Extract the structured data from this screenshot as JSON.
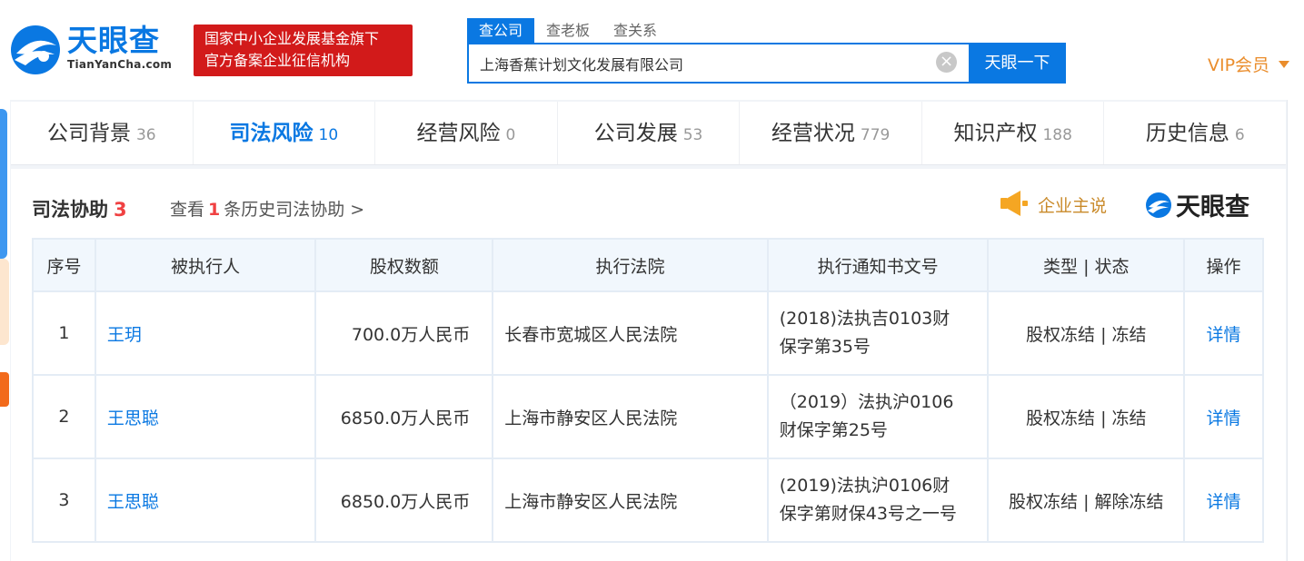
{
  "header": {
    "logo_cn": "天眼查",
    "logo_en": "TianYanCha.com",
    "gov_badge": {
      "line1": "国家中小企业发展基金旗下",
      "line2": "官方备案企业征信机构"
    },
    "search_tabs": [
      "查公司",
      "查老板",
      "查关系"
    ],
    "search_value": "上海香蕉计划文化发展有限公司",
    "search_button": "天眼一下",
    "vip": "VIP会员"
  },
  "category_tabs": [
    {
      "label": "公司背景",
      "count": "36"
    },
    {
      "label": "司法风险",
      "count": "10"
    },
    {
      "label": "经营风险",
      "count": "0"
    },
    {
      "label": "公司发展",
      "count": "53"
    },
    {
      "label": "经营状况",
      "count": "779"
    },
    {
      "label": "知识产权",
      "count": "188"
    },
    {
      "label": "历史信息",
      "count": "6"
    }
  ],
  "section": {
    "title": "司法协助",
    "count": "3",
    "history_prefix": "查看",
    "history_count": "1",
    "history_suffix": "条历史司法协助 >",
    "company_say": "企业主说",
    "watermark": "天眼查"
  },
  "table": {
    "headers": [
      "序号",
      "被执行人",
      "股权数额",
      "执行法院",
      "执行通知书文号",
      "类型 | 状态",
      "操作"
    ],
    "rows": [
      {
        "no": "1",
        "person": "王玥",
        "amount": "700.0万人民币",
        "court": "长春市宽城区人民法院",
        "doc_line1": "(2018)法执吉0103财",
        "doc_line2": "保字第35号",
        "status": "股权冻结 | 冻结",
        "action": "详情"
      },
      {
        "no": "2",
        "person": "王思聪",
        "amount": "6850.0万人民币",
        "court": "上海市静安区人民法院",
        "doc_line1": "（2019）法执沪0106",
        "doc_line2": "财保字第25号",
        "status": "股权冻结 | 冻结",
        "action": "详情"
      },
      {
        "no": "3",
        "person": "王思聪",
        "amount": "6850.0万人民币",
        "court": "上海市静安区人民法院",
        "doc_line1": "(2019)法执沪0106财",
        "doc_line2": "保字第财保43号之一号",
        "status": "股权冻结 | 解除冻结",
        "action": "详情"
      }
    ]
  },
  "colors": {
    "brand_blue": "#0a78e2",
    "badge_red": "#d21a1a",
    "vip_orange": "#ea8d2c",
    "count_red": "#f04142"
  }
}
